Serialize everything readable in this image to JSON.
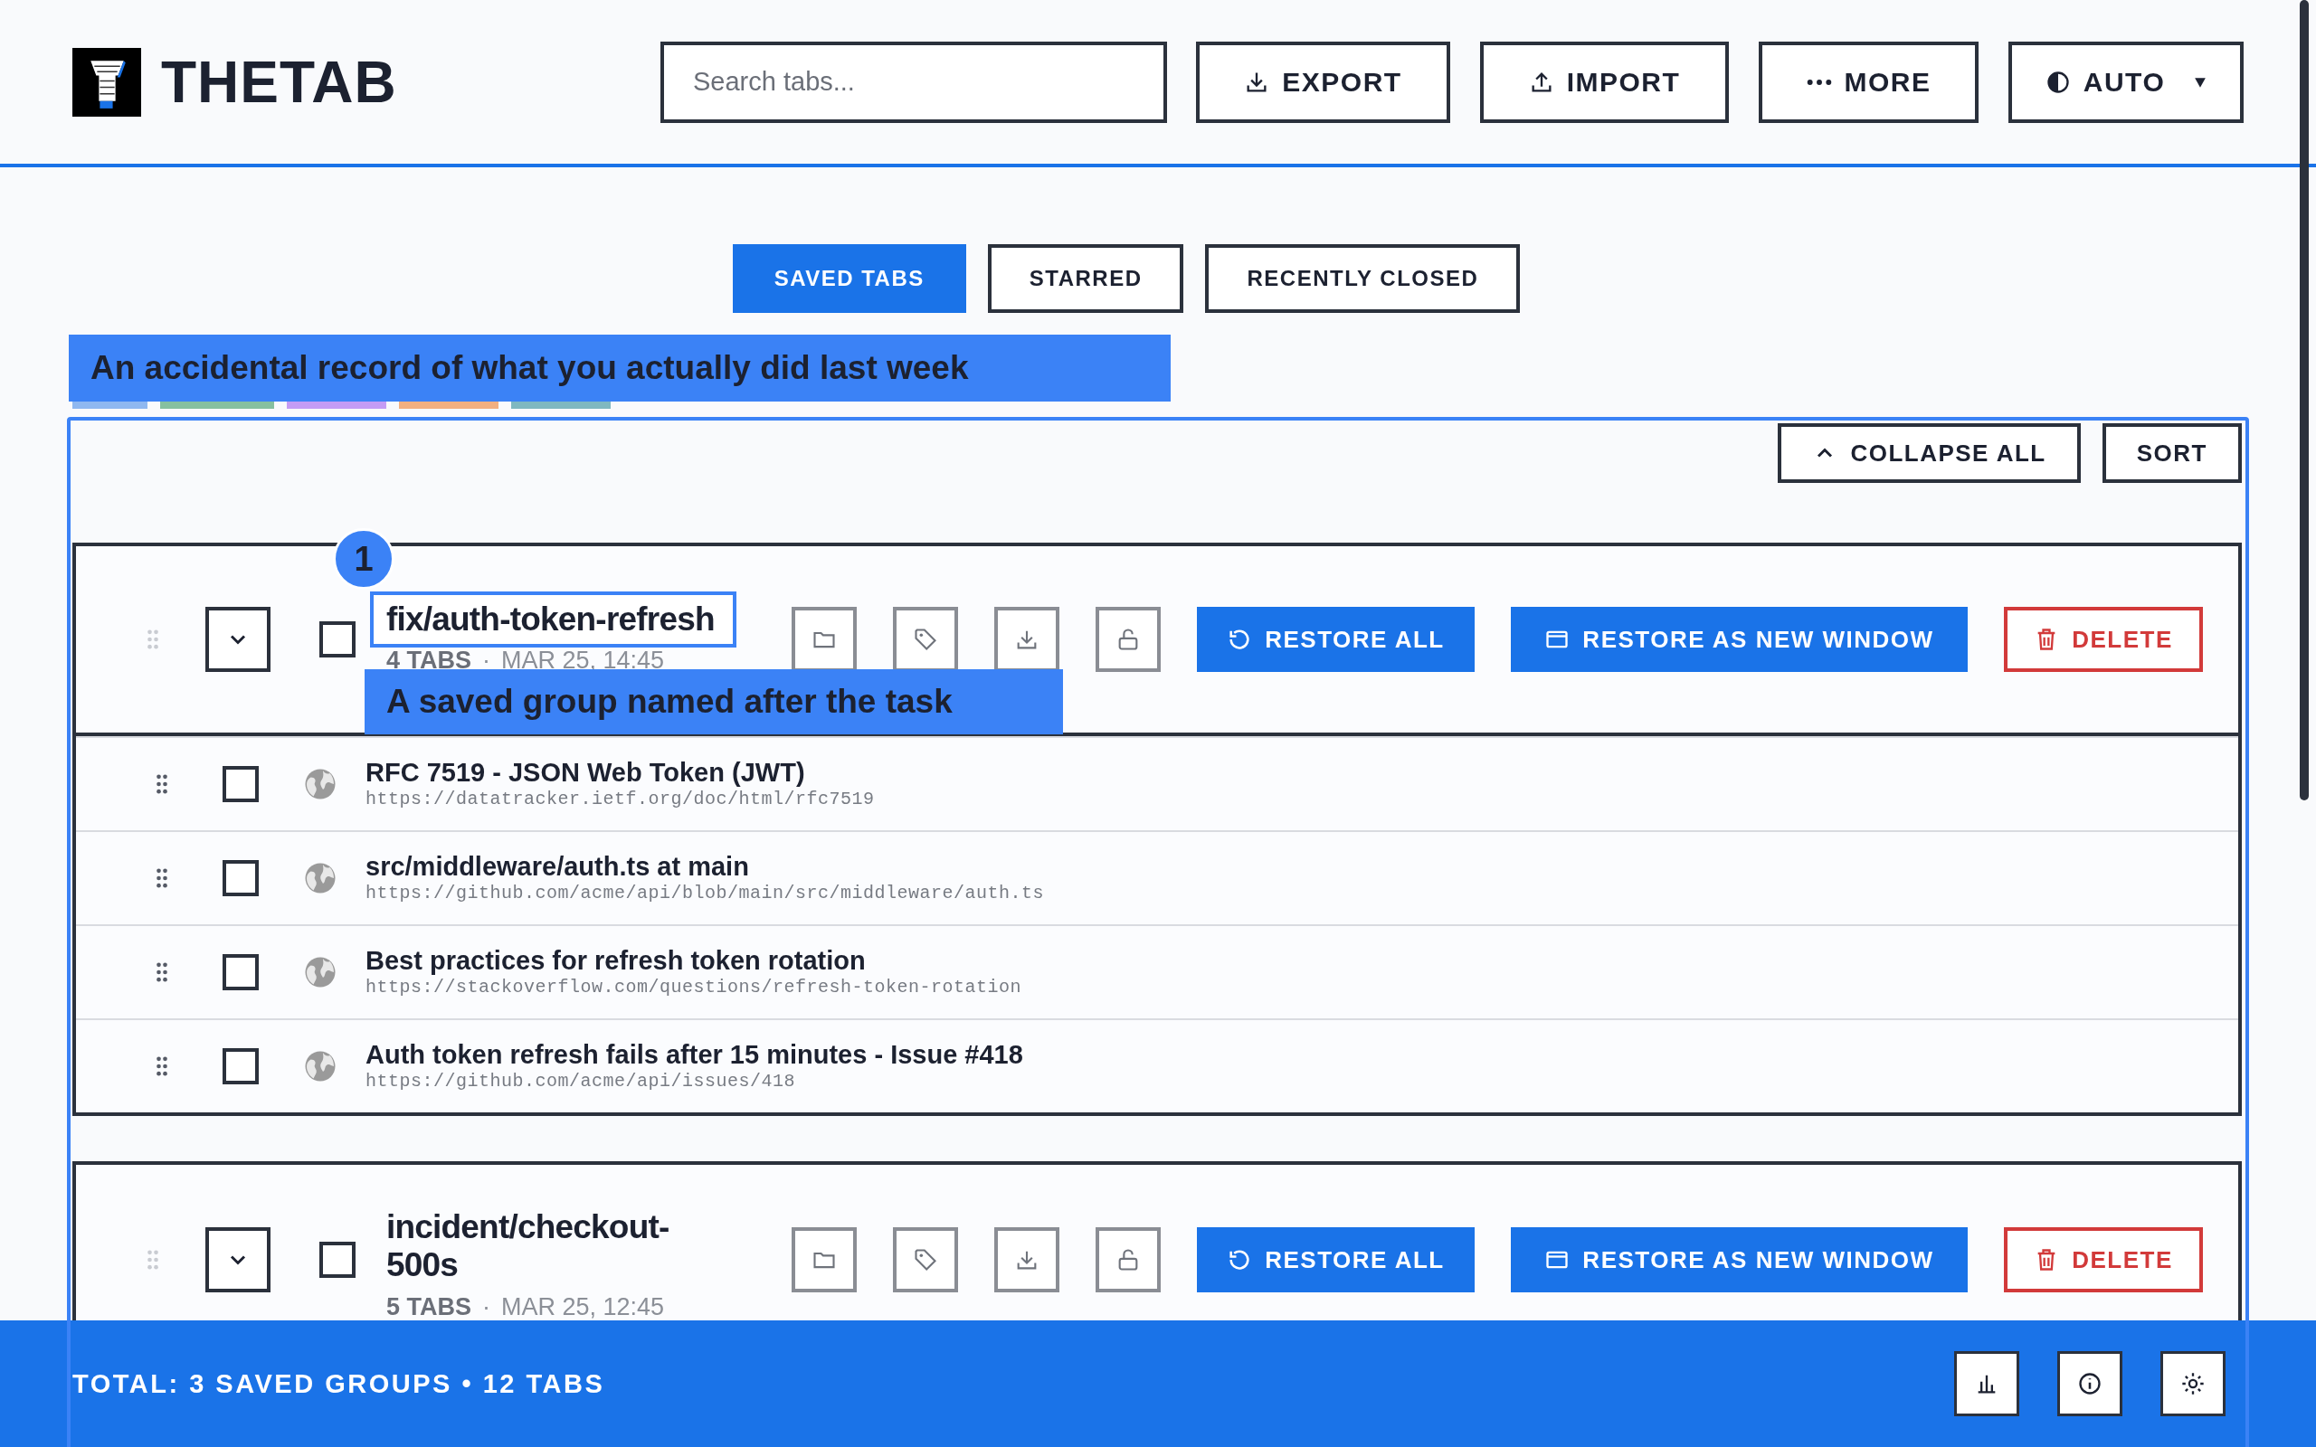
{
  "app": {
    "name": "THETAB"
  },
  "search": {
    "placeholder": "Search tabs..."
  },
  "header_buttons": [
    {
      "kind": "export",
      "label": "EXPORT"
    },
    {
      "kind": "import",
      "label": "IMPORT"
    },
    {
      "kind": "more",
      "label": "MORE"
    },
    {
      "kind": "theme",
      "label": "AUTO"
    }
  ],
  "view_tabs": [
    {
      "label": "SAVED TABS",
      "selected": true
    },
    {
      "label": "STARRED",
      "selected": false
    },
    {
      "label": "RECENTLY CLOSED",
      "selected": false
    }
  ],
  "tag_strips": [
    {
      "color": "#8fb8f0"
    },
    {
      "color": "#86c0a0"
    },
    {
      "color": "#c49cf5"
    },
    {
      "color": "#f2b080"
    },
    {
      "color": "#7fb8c0"
    }
  ],
  "toolbar": {
    "collapse": "COLLAPSE ALL",
    "sort": "SORT"
  },
  "groups": [
    {
      "title": "fix/auth-token-refresh",
      "count": "4 TABS",
      "separator": "·",
      "date": "MAR 25, 14:45",
      "checked": false,
      "highlighted": true,
      "actions": [
        {
          "kind": "restore",
          "label": "RESTORE ALL"
        },
        {
          "kind": "window",
          "label": "RESTORE AS NEW WINDOW"
        },
        {
          "kind": "delete",
          "label": "DELETE"
        }
      ],
      "tabs": [
        {
          "title": "RFC 7519 - JSON Web Token (JWT)",
          "url": "https://datatracker.ietf.org/doc/html/rfc7519",
          "checked": false
        },
        {
          "title": "src/middleware/auth.ts at main",
          "url": "https://github.com/acme/api/blob/main/src/middleware/auth.ts",
          "checked": false
        },
        {
          "title": "Best practices for refresh token rotation",
          "url": "https://stackoverflow.com/questions/refresh-token-rotation",
          "checked": false
        },
        {
          "title": "Auth token refresh fails after 15 minutes - Issue #418",
          "url": "https://github.com/acme/api/issues/418",
          "checked": false
        }
      ]
    },
    {
      "title": "incident/checkout-500s",
      "count": "5 TABS",
      "separator": "·",
      "date": "MAR 25, 12:45",
      "checked": false,
      "highlighted": false,
      "actions": [
        {
          "kind": "restore",
          "label": "RESTORE ALL"
        },
        {
          "kind": "window",
          "label": "RESTORE AS NEW WINDOW"
        },
        {
          "kind": "delete",
          "label": "DELETE"
        }
      ]
    }
  ],
  "callouts": {
    "page": "An accidental record of what you actually did last week",
    "step": "1",
    "group": "A saved group named after the task"
  },
  "footer": {
    "total": "TOTAL: 3 SAVED GROUPS • 12 TABS",
    "buttons": [
      {
        "kind": "stats"
      },
      {
        "kind": "info"
      },
      {
        "kind": "settings"
      }
    ]
  }
}
